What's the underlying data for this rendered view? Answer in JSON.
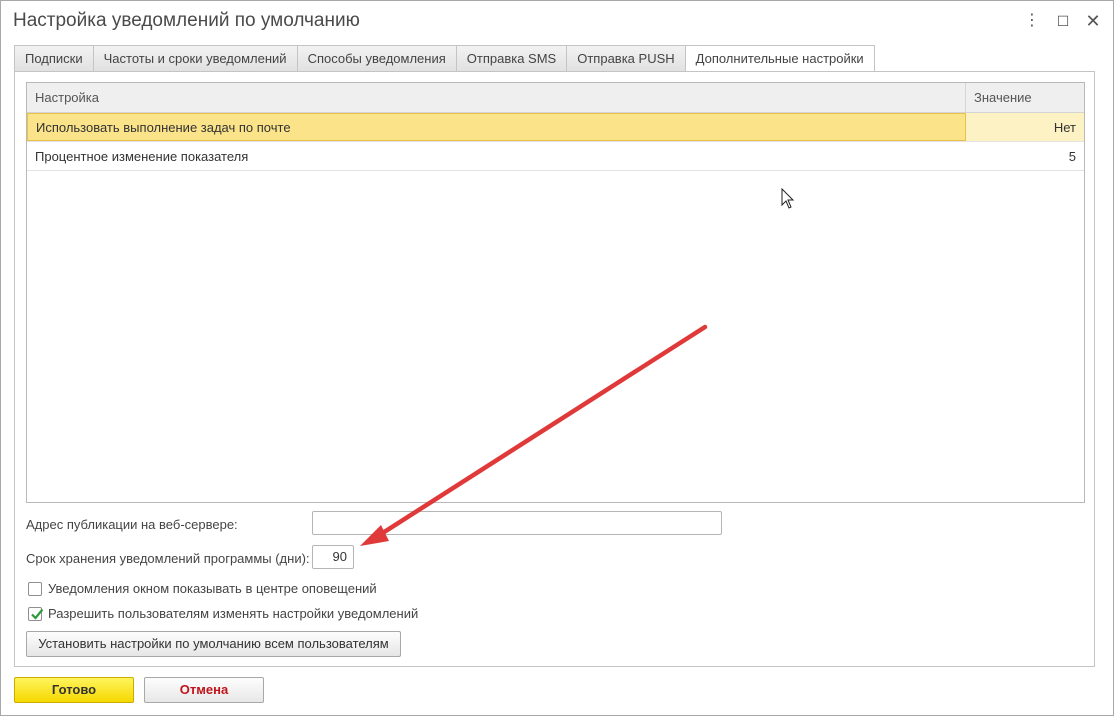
{
  "window": {
    "title": "Настройка уведомлений по умолчанию"
  },
  "icons": {
    "menu": "more-vertical-icon",
    "maximize": "maximize-icon",
    "close": "close-icon",
    "check": "checkmark-icon",
    "cursor": "mouse-cursor-icon",
    "annotation": "red-arrow-annotation"
  },
  "tabs": [
    {
      "label": "Подписки",
      "active": false
    },
    {
      "label": "Частоты и сроки уведомлений",
      "active": false
    },
    {
      "label": "Способы уведомления",
      "active": false
    },
    {
      "label": "Отправка SMS",
      "active": false
    },
    {
      "label": "Отправка PUSH",
      "active": false
    },
    {
      "label": "Дополнительные настройки",
      "active": true
    }
  ],
  "grid": {
    "columns": [
      "Настройка",
      "Значение"
    ],
    "rows": [
      {
        "setting": "Использовать выполнение задач по почте",
        "value": "Нет",
        "selected": true
      },
      {
        "setting": "Процентное изменение показателя",
        "value": "5",
        "selected": false
      }
    ]
  },
  "form": {
    "publish_address_label": "Адрес публикации на веб-сервере:",
    "publish_address_value": "",
    "retention_label": "Срок хранения уведомлений программы (дни):",
    "retention_value": "90",
    "center_checkbox_label": "Уведомления окном показывать в центре оповещений",
    "center_checkbox_checked": false,
    "allow_checkbox_label": "Разрешить пользователям изменять настройки уведомлений",
    "allow_checkbox_checked": true,
    "set_defaults_button": "Установить настройки по умолчанию всем пользователям"
  },
  "footer": {
    "ok_label": "Готово",
    "cancel_label": "Отмена"
  },
  "colors": {
    "accent_yellow": "#f5d800",
    "selection": "#fbe38a",
    "cancel_text": "#c0141b",
    "arrow": "#e0393a"
  }
}
